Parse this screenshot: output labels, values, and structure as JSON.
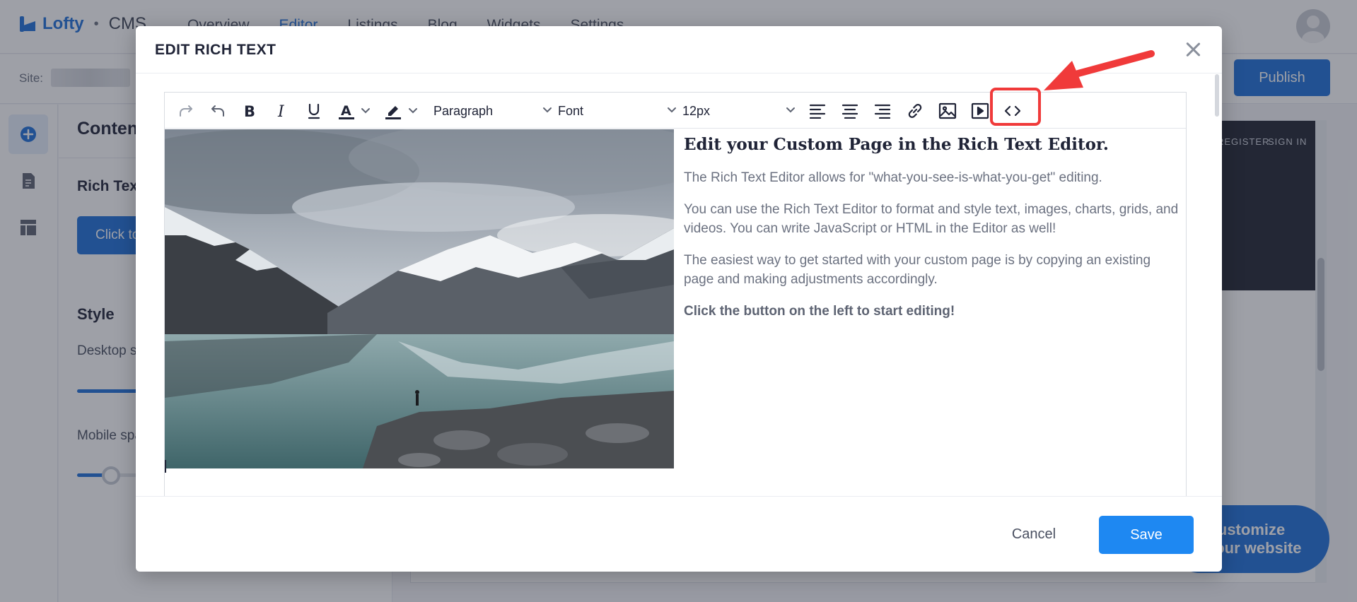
{
  "app": {
    "logo_text": "Lofty",
    "logo_dot": "•",
    "product": "CMS",
    "nav": [
      "Overview",
      "Editor",
      "Listings",
      "Blog",
      "Widgets",
      "Settings"
    ],
    "active_nav": "Editor",
    "site_label": "Site:",
    "publish_label": "Publish"
  },
  "panel": {
    "heading": "Content",
    "sub_heading": "Rich Text",
    "button_label": "Click to edit",
    "style_heading": "Style",
    "desktop_label": "Desktop spacing",
    "mobile_label": "Mobile spacing",
    "desktop_slider_value": 0.3,
    "mobile_slider_value": 0.12
  },
  "preview": {
    "top_links": [
      "REGISTER",
      "SIGN IN"
    ],
    "fab_line1": "Customize",
    "fab_line2": "your website"
  },
  "modal": {
    "title": "EDIT RICH TEXT",
    "toolbar": {
      "paragraph_value": "Paragraph",
      "font_value": "Font",
      "size_value": "12px"
    },
    "content": {
      "heading": "Edit your Custom Page in the Rich Text Editor.",
      "paragraphs": [
        "The Rich Text Editor allows for \"what-you-see-is-what-you-get\" editing.",
        "You can use the Rich Text Editor to format and style text, images, charts, grids, and videos. You can write JavaScript or HTML in the Editor as well!",
        "The easiest way to get started with your custom page is by copying an existing page and making adjustments accordingly."
      ],
      "bold_line": "Click the button on the left to start editing!"
    },
    "cancel_label": "Cancel",
    "save_label": "Save"
  },
  "colors": {
    "brand_blue": "#1e6fd9",
    "save_blue": "#1e88f2",
    "annotation_red": "#f03a3a"
  }
}
